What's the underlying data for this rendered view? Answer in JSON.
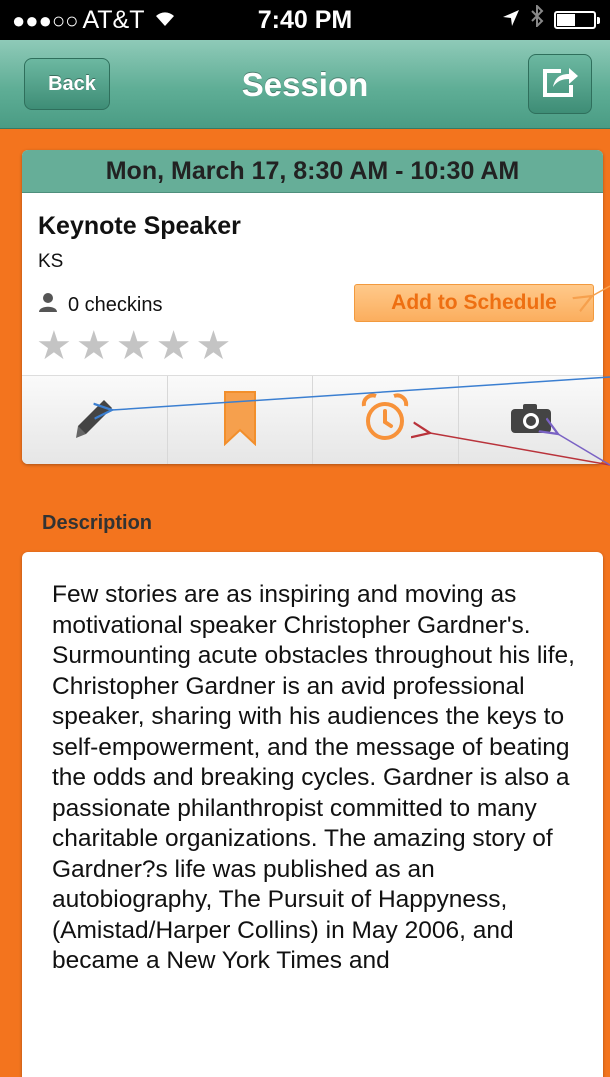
{
  "status_bar": {
    "signal": "●●●○○",
    "carrier": "AT&T",
    "time": "7:40 PM"
  },
  "nav": {
    "back_label": "Back",
    "title": "Session"
  },
  "session": {
    "datetime": "Mon, March 17, 8:30 AM - 10:30 AM",
    "title": "Keynote Speaker",
    "code": "KS",
    "checkins": "0 checkins",
    "rating": 0,
    "add_to_schedule_label": "Add to Schedule"
  },
  "toolbar": {
    "items": [
      "pencil-icon",
      "bookmark-icon",
      "alarm-icon",
      "camera-icon"
    ]
  },
  "description": {
    "label": "Description",
    "text": "Few stories are as inspiring and moving as motivational speaker Christopher Gardner's. Surmounting acute obstacles throughout his life, Christopher Gardner is an avid professional speaker, sharing with his audiences the keys to self-empowerment, and the message of beating the odds and breaking cycles. Gardner is also a passionate philanthropist committed to many charitable organizations. The amazing story of Gardner?s life was published as an autobiography, The Pursuit of Happyness, (Amistad/Harper Collins) in May 2006, and became a New York Times and"
  },
  "colors": {
    "background": "#f3741e",
    "nav_green": "#5fae96",
    "accent_orange": "#f7923a"
  }
}
